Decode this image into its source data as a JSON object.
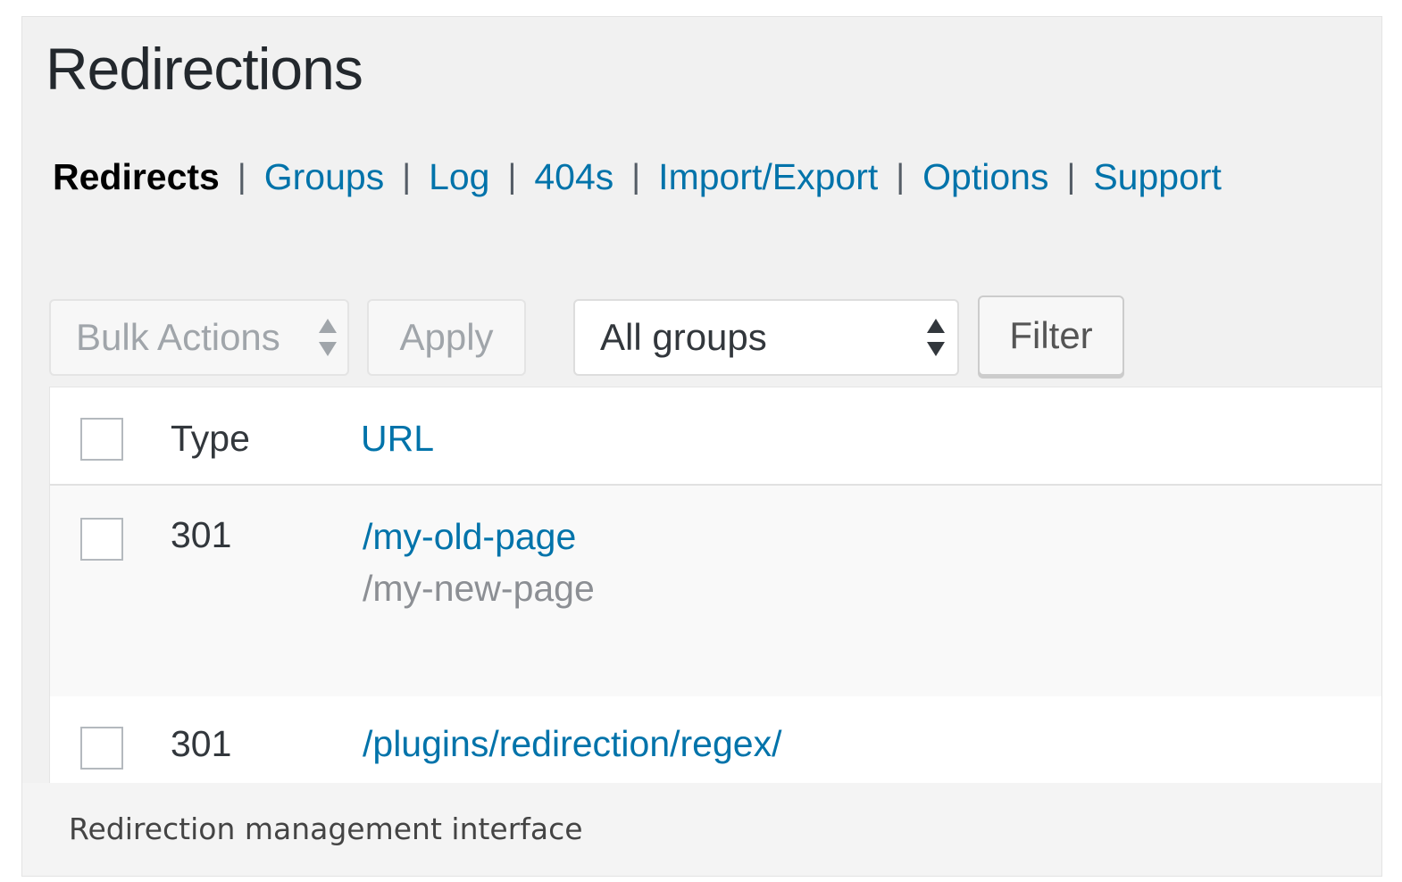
{
  "page": {
    "title": "Redirections"
  },
  "subnav": {
    "items": [
      {
        "label": "Redirects",
        "current": true
      },
      {
        "label": "Groups",
        "current": false
      },
      {
        "label": "Log",
        "current": false
      },
      {
        "label": "404s",
        "current": false
      },
      {
        "label": "Import/Export",
        "current": false
      },
      {
        "label": "Options",
        "current": false
      },
      {
        "label": "Support",
        "current": false
      }
    ],
    "separator": "|"
  },
  "toolbar": {
    "bulk_actions_label": "Bulk Actions",
    "apply_label": "Apply",
    "group_select_value": "All groups",
    "filter_label": "Filter"
  },
  "table": {
    "columns": [
      "Type",
      "URL"
    ],
    "rows": [
      {
        "type": "301",
        "url": "/my-old-page",
        "target": "/my-new-page"
      },
      {
        "type": "301",
        "url": "/plugins/redirection/regex/",
        "target": ""
      }
    ]
  },
  "caption": "Redirection management interface",
  "colors": {
    "link": "#0073aa",
    "text": "#23282d",
    "muted": "#a0a5aa"
  }
}
